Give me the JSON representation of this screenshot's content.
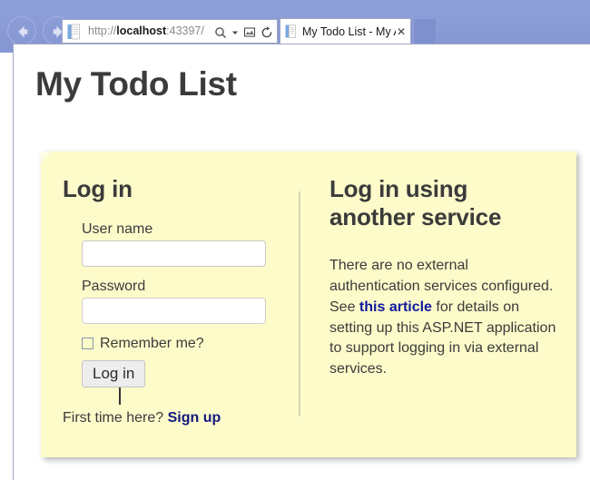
{
  "browser": {
    "back_icon": "back-arrow-icon",
    "forward_icon": "forward-arrow-icon",
    "address": {
      "protocol": "http://",
      "host": "localhost",
      "rest": ":43397/",
      "favicon": "page-icon",
      "search_icon": "search-icon",
      "dropdown_icon": "chevron-down-icon",
      "compat_icon": "compatibility-view-icon",
      "refresh_icon": "refresh-icon"
    },
    "tab": {
      "title": "My Todo List - My A...",
      "favicon": "page-icon",
      "close_label": "✕"
    }
  },
  "page": {
    "title": "My Todo List",
    "login": {
      "heading": "Log in",
      "username_label": "User name",
      "username_value": "",
      "username_placeholder": "",
      "password_label": "Password",
      "password_value": "",
      "password_placeholder": "",
      "remember_label": "Remember me?",
      "remember_checked": false,
      "submit_label": "Log in"
    },
    "signup": {
      "prompt": "First time here?",
      "link_label": "Sign up"
    },
    "external": {
      "heading": "Log in using another service",
      "text_before": "There are no external authentication services configured. See ",
      "link_label": "this article",
      "text_after": " for details on setting up this ASP.NET application to support logging in via external services."
    }
  },
  "colors": {
    "chrome": "#8a9ad5",
    "panel": "#fdfbca",
    "link": "#12197e",
    "heading": "#3b3b3b"
  }
}
